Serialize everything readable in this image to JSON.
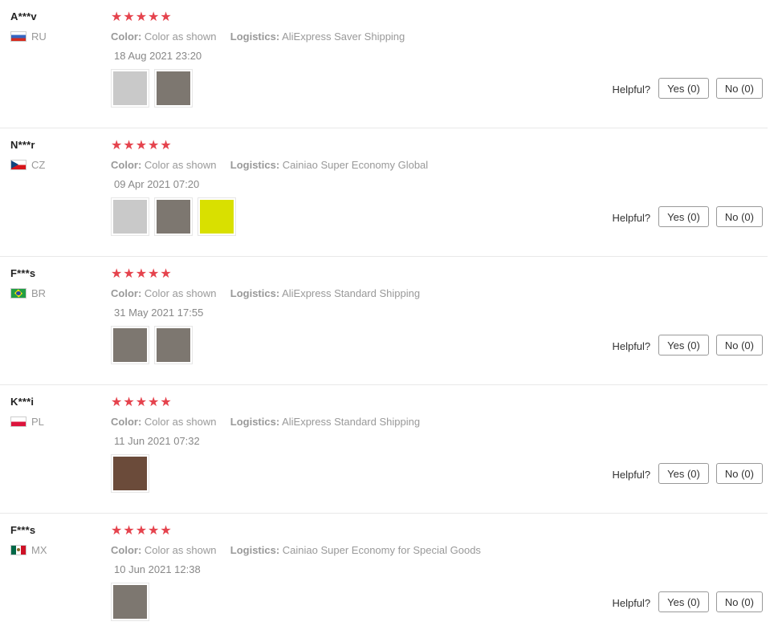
{
  "labels": {
    "color": "Color:",
    "logistics": "Logistics:",
    "helpful": "Helpful?",
    "yes": "Yes (0)",
    "no": "No (0)",
    "star": "★"
  },
  "reviews": [
    {
      "user": "A***v",
      "country": "RU",
      "flag": "flag-ru",
      "rating": 5,
      "color": "Color as shown",
      "logistics": "AliExpress Saver Shipping",
      "date": "18 Aug 2021 23:20",
      "photos": [
        "ph-white",
        "ph-target"
      ]
    },
    {
      "user": "N***r",
      "country": "CZ",
      "flag": "flag-cz",
      "rating": 5,
      "color": "Color as shown",
      "logistics": "Cainiao Super Economy Global",
      "date": "09 Apr 2021 07:20",
      "photos": [
        "ph-white",
        "ph-target",
        "ph-yellow"
      ]
    },
    {
      "user": "F***s",
      "country": "BR",
      "flag": "flag-br",
      "rating": 5,
      "color": "Color as shown",
      "logistics": "AliExpress Standard Shipping",
      "date": "31 May 2021 17:55",
      "photos": [
        "ph-target",
        "ph-target"
      ]
    },
    {
      "user": "K***i",
      "country": "PL",
      "flag": "flag-pl",
      "rating": 5,
      "color": "Color as shown",
      "logistics": "AliExpress Standard Shipping",
      "date": "11 Jun 2021 07:32",
      "photos": [
        "ph-brown"
      ]
    },
    {
      "user": "F***s",
      "country": "MX",
      "flag": "flag-mx",
      "rating": 5,
      "color": "Color as shown",
      "logistics": "Cainiao Super Economy for Special Goods",
      "date": "10 Jun 2021 12:38",
      "photos": [
        "ph-target"
      ]
    }
  ]
}
